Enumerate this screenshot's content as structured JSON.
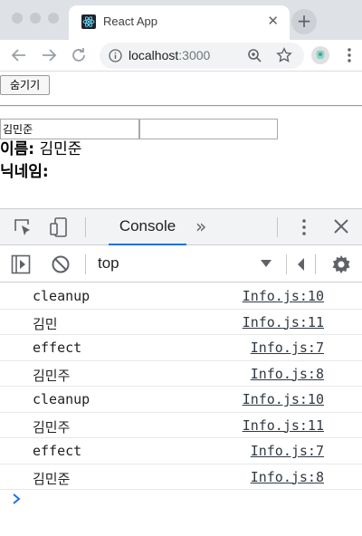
{
  "browser": {
    "tab_title": "React App",
    "tab_close": "✕",
    "new_tab": "+",
    "url_host": "localhost",
    "url_port": ":3000",
    "icons": [
      "react-favicon",
      "back-icon",
      "forward-icon",
      "reload-icon",
      "info-icon",
      "zoom-icon",
      "star-icon",
      "extension-icon",
      "menu-icon"
    ]
  },
  "page": {
    "hide_button": "숨기기",
    "name_input_value": "김민준",
    "nickname_input_value": "",
    "name_label": "이름:",
    "name_value": "김민준",
    "nickname_label": "닉네임:",
    "nickname_value": ""
  },
  "devtools": {
    "active_tab": "Console",
    "more_tabs": "»",
    "context": "top",
    "logs": [
      {
        "message": "cleanup",
        "source": "Info.js:10"
      },
      {
        "message": "김민",
        "source": "Info.js:11"
      },
      {
        "message": "effect",
        "source": "Info.js:7"
      },
      {
        "message": "김민주",
        "source": "Info.js:8"
      },
      {
        "message": "cleanup",
        "source": "Info.js:10"
      },
      {
        "message": "김민주",
        "source": "Info.js:11"
      },
      {
        "message": "effect",
        "source": "Info.js:7"
      },
      {
        "message": "김민준",
        "source": "Info.js:8"
      }
    ]
  },
  "colors": {
    "accent": "#1a73e8",
    "chrome_bg": "#dee1e6",
    "devtools_bar": "#f1f3f4"
  }
}
